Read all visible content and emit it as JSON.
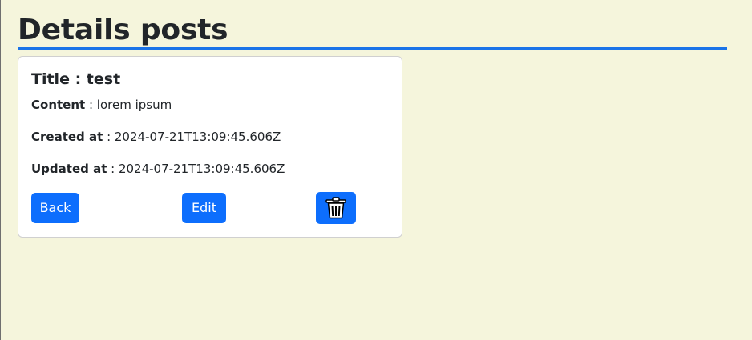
{
  "page": {
    "title": "Details posts"
  },
  "post": {
    "title_label": "Title",
    "title_value": "test",
    "content_label": "Content",
    "content_value": "lorem ipsum",
    "created_label": "Created at",
    "created_value": "2024-07-21T13:09:45.606Z",
    "updated_label": "Updated at",
    "updated_value": "2024-07-21T13:09:45.606Z",
    "separator": " : "
  },
  "actions": {
    "back_label": "Back",
    "edit_label": "Edit",
    "delete_icon": "trash-icon"
  },
  "colors": {
    "background": "#f5f5dc",
    "accent_rule": "#1a73e8",
    "button": "#0d6efd"
  }
}
